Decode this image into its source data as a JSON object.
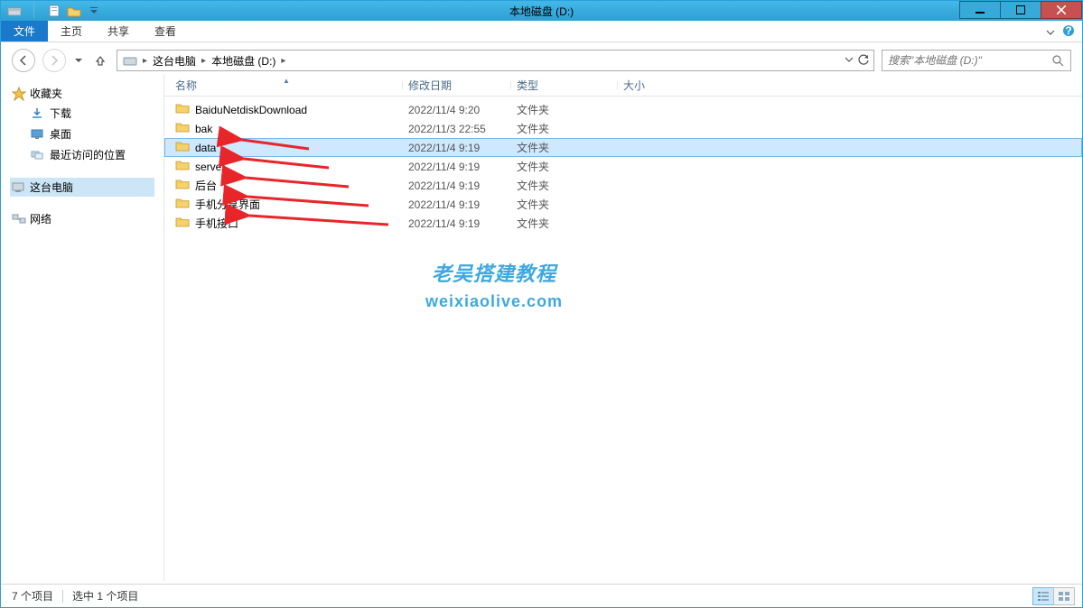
{
  "window": {
    "title": "本地磁盘 (D:)"
  },
  "ribbon": {
    "file": "文件",
    "tabs": [
      "主页",
      "共享",
      "查看"
    ]
  },
  "breadcrumb": {
    "segments": [
      "这台电脑",
      "本地磁盘 (D:)"
    ]
  },
  "search": {
    "placeholder": "搜索\"本地磁盘 (D:)\""
  },
  "sidebar": {
    "favorites": {
      "title": "收藏夹",
      "items": [
        "下载",
        "桌面",
        "最近访问的位置"
      ]
    },
    "computer": {
      "title": "这台电脑"
    },
    "network": {
      "title": "网络"
    }
  },
  "columns": {
    "name": "名称",
    "date": "修改日期",
    "type": "类型",
    "size": "大小"
  },
  "files": [
    {
      "name": "BaiduNetdiskDownload",
      "date": "2022/11/4 9:20",
      "type": "文件夹",
      "selected": false,
      "arrow": false
    },
    {
      "name": "bak",
      "date": "2022/11/3 22:55",
      "type": "文件夹",
      "selected": false,
      "arrow": false
    },
    {
      "name": "data",
      "date": "2022/11/4 9:19",
      "type": "文件夹",
      "selected": true,
      "arrow": true
    },
    {
      "name": "server",
      "date": "2022/11/4 9:19",
      "type": "文件夹",
      "selected": false,
      "arrow": true
    },
    {
      "name": "后台",
      "date": "2022/11/4 9:19",
      "type": "文件夹",
      "selected": false,
      "arrow": true
    },
    {
      "name": "手机分享界面",
      "date": "2022/11/4 9:19",
      "type": "文件夹",
      "selected": false,
      "arrow": true
    },
    {
      "name": "手机接口",
      "date": "2022/11/4 9:19",
      "type": "文件夹",
      "selected": false,
      "arrow": true
    }
  ],
  "watermark": {
    "line1": "老吴搭建教程",
    "line2": "weixiaolive.com"
  },
  "status": {
    "count": "7 个项目",
    "selected": "选中 1 个项目"
  }
}
